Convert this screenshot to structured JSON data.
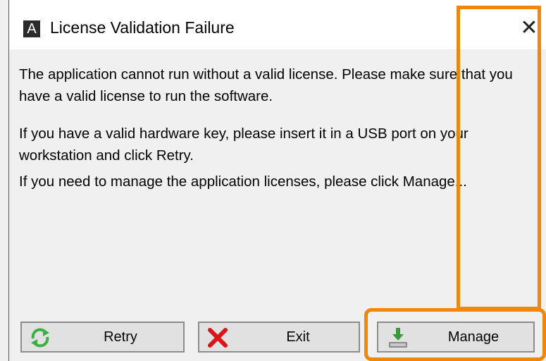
{
  "window": {
    "title": "License Validation Failure",
    "app_icon_letter": "A",
    "close_glyph": "✕"
  },
  "messages": [
    "The application cannot run without a valid license. Please make sure that you have a valid license to run the software.",
    "If you have a valid hardware key, please insert it in a USB port on your workstation and click Retry.",
    "If you need to manage the application licenses, please click Manage..."
  ],
  "buttons": {
    "retry": {
      "label": "Retry",
      "icon": "refresh-icon"
    },
    "exit": {
      "label": "Exit",
      "icon": "close-x-icon"
    },
    "manage": {
      "label": "Manage",
      "icon": "download-drive-icon"
    }
  },
  "colors": {
    "highlight": "#f0870a",
    "retry_icon": "#3cb043",
    "exit_icon": "#d9141b",
    "manage_icon": "#3a9a3a"
  }
}
